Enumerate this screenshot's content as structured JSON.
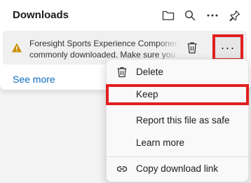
{
  "flyout": {
    "title": "Downloads",
    "header_icons": [
      "folder-icon",
      "search-icon",
      "more-icon",
      "pin-icon"
    ],
    "see_more": "See more"
  },
  "download": {
    "line1": "Foresight Sports Experience Componen",
    "line2": "commonly downloaded. Make sure you",
    "more_label": "···",
    "status_icon": "warning-icon"
  },
  "menu": {
    "items": [
      {
        "label": "Delete",
        "icon": "trash-icon"
      },
      {
        "label": "Keep",
        "icon": ""
      },
      {
        "label": "Report this file as safe",
        "icon": ""
      },
      {
        "label": "Learn more",
        "icon": ""
      },
      {
        "label": "Copy download link",
        "icon": "link-icon"
      }
    ]
  },
  "colors": {
    "highlight": "#e02020",
    "link": "#0f6cbd",
    "warning": "#c98c00"
  }
}
